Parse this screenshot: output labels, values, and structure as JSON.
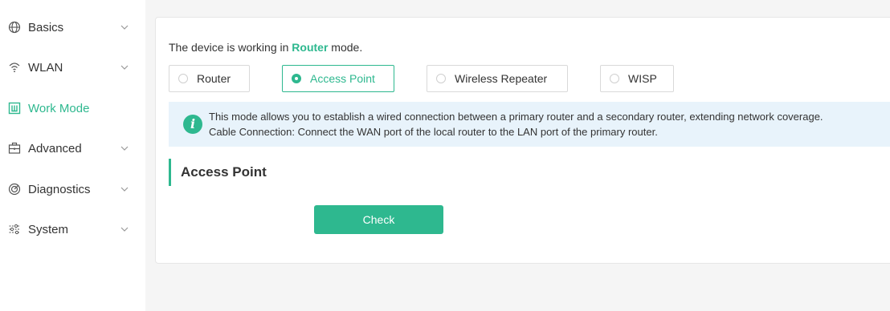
{
  "sidebar": {
    "items": [
      {
        "label": "Basics",
        "icon": "globe-icon",
        "expandable": true
      },
      {
        "label": "WLAN",
        "icon": "wifi-icon",
        "expandable": true
      },
      {
        "label": "Work Mode",
        "icon": "work-mode-icon",
        "expandable": false,
        "active": true
      },
      {
        "label": "Advanced",
        "icon": "advanced-icon",
        "expandable": true
      },
      {
        "label": "Diagnostics",
        "icon": "diagnostics-icon",
        "expandable": true
      },
      {
        "label": "System",
        "icon": "system-icon",
        "expandable": true
      }
    ]
  },
  "main": {
    "status_prefix": "The device is working in ",
    "status_mode": "Router",
    "status_suffix": " mode.",
    "mode_options": [
      {
        "label": "Router",
        "selected": false
      },
      {
        "label": "Access Point",
        "selected": true
      },
      {
        "label": "Wireless Repeater",
        "selected": false
      },
      {
        "label": "WISP",
        "selected": false
      }
    ],
    "info": {
      "icon": "info-icon",
      "line1": "This mode allows you to establish a wired connection between a primary router and a secondary router, extending network coverage.",
      "line2": "Cable Connection: Connect the WAN port of the local router to the LAN port of the primary router."
    },
    "section_title": "Access Point",
    "check_label": "Check"
  },
  "colors": {
    "accent": "#2eb88f",
    "info_bg": "#e8f3fb",
    "page_bg": "#f5f5f5"
  }
}
